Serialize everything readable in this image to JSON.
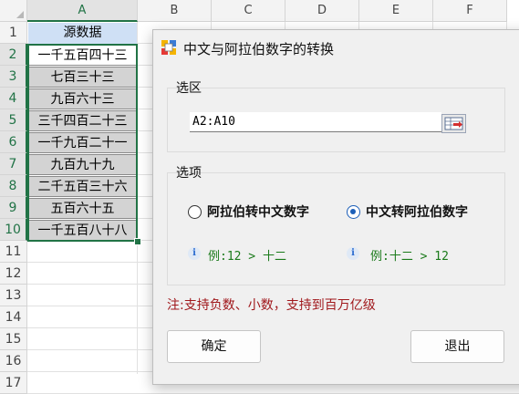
{
  "sheet": {
    "columns": [
      "A",
      "B",
      "C",
      "D",
      "E",
      "F"
    ],
    "rows": [
      "1",
      "2",
      "3",
      "4",
      "5",
      "6",
      "7",
      "8",
      "9",
      "10",
      "11",
      "12",
      "13",
      "14",
      "15",
      "16",
      "17"
    ],
    "header_cell": "源数据",
    "cells": [
      "一千五百四十三",
      "七百三十三",
      "九百六十三",
      "三千四百二十三",
      "一千九百二十一",
      "九百九十九",
      "二千五百三十六",
      "五百六十五",
      "一千五百八十八"
    ]
  },
  "dialog": {
    "title": "中文与阿拉伯数字的转换",
    "range_group_label": "选区",
    "range_value": "A2:A10",
    "options_group_label": "选项",
    "option1_label": "阿拉伯转中文数字",
    "option2_label": "中文转阿拉伯数字",
    "option1_example": "例:12 > 十二",
    "option2_example": "例:十二 > 12",
    "selected_option": "option2",
    "note": "注:支持负数、小数，支持到百万亿级",
    "ok_label": "确定",
    "cancel_label": "退出"
  },
  "icons": {
    "app": "app-logo-icon",
    "range_picker": "range-select-icon",
    "info": "info-icon"
  },
  "colors": {
    "excel_green": "#217346",
    "header_fill": "#cfe0f5",
    "data_fill": "#d3d3d3",
    "note_red": "#a0181c",
    "example_green": "#1b7a1b",
    "radio_blue": "#1d5fb8"
  }
}
